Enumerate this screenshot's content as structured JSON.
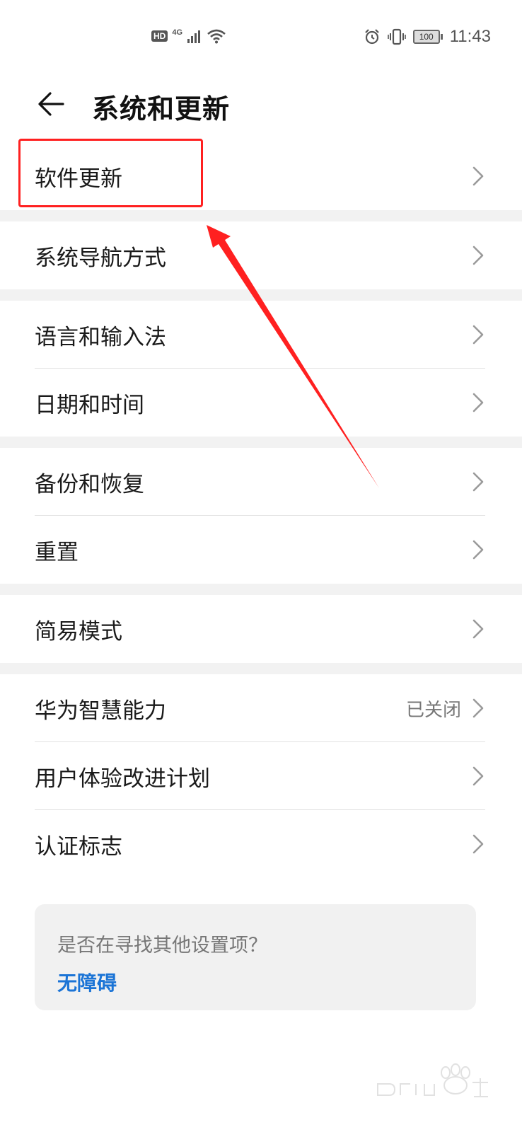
{
  "status_bar": {
    "hd": "HD",
    "network": "4G",
    "battery": "100",
    "time": "11:43"
  },
  "header": {
    "title": "系统和更新"
  },
  "menu": {
    "software_update": "软件更新",
    "system_navigation": "系统导航方式",
    "language_input": "语言和输入法",
    "date_time": "日期和时间",
    "backup_restore": "备份和恢复",
    "reset": "重置",
    "simple_mode": "简易模式",
    "huawei_ability": "华为智慧能力",
    "huawei_ability_status": "已关闭",
    "user_experience": "用户体验改进计划",
    "certification": "认证标志"
  },
  "suggestion": {
    "question": "是否在寻找其他设置项？",
    "link": "无障碍"
  },
  "annotation": {
    "color": "#ff2020"
  }
}
